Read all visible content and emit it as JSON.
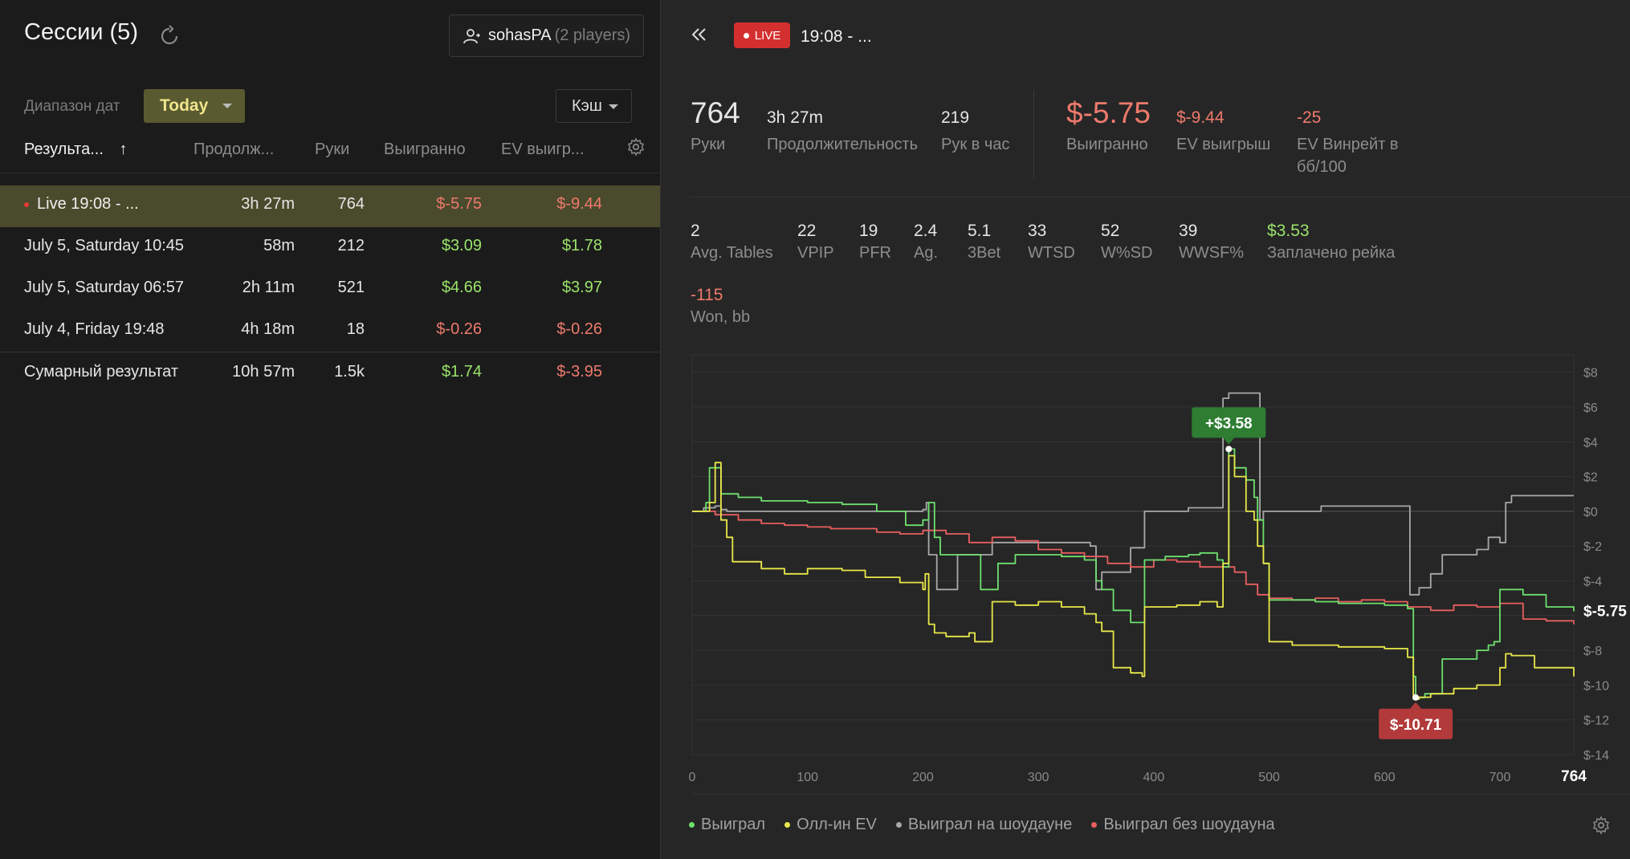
{
  "sessions": {
    "title": "Сессии (5)",
    "player_name": "sohasPA",
    "player_count": "(2 players)",
    "date_range_label": "Диапазон дат",
    "date_range_value": "Today",
    "game_type": "Кэш",
    "columns": [
      "Результа...",
      "Продолж...",
      "Руки",
      "Выигранно",
      "EV выигр..."
    ],
    "sort_arrow": "↑",
    "rows": [
      {
        "name": "Live 19:08 - ...",
        "duration": "3h 27m",
        "hands": "764",
        "won": "$-5.75",
        "ev": "$-9.44"
      },
      {
        "name": "July 5, Saturday 10:45",
        "duration": "58m",
        "hands": "212",
        "won": "$3.09",
        "ev": "$1.78"
      },
      {
        "name": "July 5, Saturday 06:57",
        "duration": "2h 11m",
        "hands": "521",
        "won": "$4.66",
        "ev": "$3.97"
      },
      {
        "name": "July 4, Friday 19:48",
        "duration": "4h 18m",
        "hands": "18",
        "won": "$-0.26",
        "ev": "$-0.26"
      }
    ],
    "total": {
      "name": "Сумарный результат",
      "duration": "10h 57m",
      "hands": "1.5k",
      "won": "$1.74",
      "ev": "$-3.95"
    }
  },
  "detail": {
    "live_badge": "LIVE",
    "session_time": "19:08 - ...",
    "summary": {
      "hands": "764",
      "hands_label": "Руки",
      "duration": "3h 27m",
      "duration_label": "Продолжительность",
      "hands_per_hour": "219",
      "hands_per_hour_label": "Рук в час",
      "won": "$-5.75",
      "won_label": "Выигранно",
      "ev_won": "$-9.44",
      "ev_won_label": "EV выигрыш",
      "ev_winrate": "-25",
      "ev_winrate_label_1": "EV Винрейт в",
      "ev_winrate_label_2": "бб/100"
    },
    "stats": [
      {
        "value": "2",
        "label": "Avg. Tables"
      },
      {
        "value": "22",
        "label": "VPIP"
      },
      {
        "value": "19",
        "label": "PFR"
      },
      {
        "value": "2.4",
        "label": "Ag."
      },
      {
        "value": "5.1",
        "label": "3Bet"
      },
      {
        "value": "33",
        "label": "WTSD"
      },
      {
        "value": "52",
        "label": "W%SD"
      },
      {
        "value": "39",
        "label": "WWSF%"
      },
      {
        "value": "$3.53",
        "label": "Заплачено рейка"
      },
      {
        "value": "-115",
        "label": "Won, bb"
      }
    ],
    "legend": [
      "Выиграл",
      "Олл-ин EV",
      "Выиграл на шоудауне",
      "Выиграл без шоудауна"
    ]
  },
  "colors": {
    "won": "#6ee06e",
    "allin_ev": "#e8e84a",
    "showdown": "#a9a9a9",
    "no_showdown": "#e95f5f",
    "positive": "#9be36b",
    "negative": "#ee7a6c",
    "live": "#d32f2f"
  },
  "icons": [
    "refresh-icon",
    "user-switch-icon",
    "gear-icon",
    "double-chevron-left-icon"
  ],
  "chart_data": {
    "type": "line",
    "xlim": [
      0,
      764
    ],
    "ylim": [
      -14,
      9
    ],
    "x_ticks": [
      0,
      100,
      200,
      300,
      400,
      500,
      600,
      700
    ],
    "x_tick_labels": [
      "0",
      "100",
      "200",
      "300",
      "400",
      "500",
      "600",
      "700"
    ],
    "x_end_label": "764",
    "y_ticks": [
      8,
      6,
      4,
      2,
      0,
      -2,
      -4,
      -6,
      -8,
      -10,
      -12,
      -14
    ],
    "y_tick_labels": [
      "$8",
      "$6",
      "$4",
      "$2",
      "$0",
      "$-2",
      "$-4",
      "",
      "$-8",
      "$-10",
      "$-12",
      "$-14"
    ],
    "current_label": "$-5.75",
    "max_callout": {
      "x": 465,
      "y": 3.58,
      "label": "+$3.58"
    },
    "min_callout": {
      "x": 627,
      "y": -10.71,
      "label": "$-10.71"
    },
    "series": [
      {
        "key": "showdown",
        "x": [
          0,
          10,
          20,
          25,
          30,
          160,
          200,
          203,
          205,
          210,
          212,
          225,
          230,
          250,
          260,
          340,
          345,
          350,
          355,
          370,
          380,
          390,
          392,
          425,
          430,
          455,
          460,
          465,
          470,
          490,
          492,
          495,
          500,
          520,
          540,
          545,
          580,
          600,
          620,
          622,
          625,
          628,
          630,
          640,
          650,
          655,
          660,
          670,
          680,
          690,
          700,
          705,
          710,
          720,
          740,
          764
        ],
        "y": [
          0,
          0.2,
          0.3,
          0.1,
          0,
          0,
          0.1,
          0.5,
          -2.5,
          -2.5,
          -4.5,
          -4.5,
          -2.5,
          -2.5,
          -1.8,
          -1.8,
          -2,
          -4.5,
          -3.5,
          -3.5,
          -2.1,
          -2.1,
          0,
          0,
          0.2,
          0.2,
          6.5,
          6.8,
          6.8,
          6.8,
          -0.5,
          0,
          0,
          0,
          0,
          0.3,
          0.3,
          0.3,
          0.3,
          -4.8,
          -4.8,
          -4.8,
          -4.4,
          -3.6,
          -2.5,
          -2.5,
          -2.5,
          -2.5,
          -2.2,
          -1.5,
          -1.8,
          0.5,
          0.9,
          0.9,
          0.9,
          0.9
        ]
      },
      {
        "key": "no_showdown",
        "x": [
          0,
          20,
          40,
          60,
          80,
          100,
          120,
          140,
          160,
          180,
          200,
          220,
          240,
          260,
          280,
          300,
          320,
          340,
          360,
          380,
          400,
          420,
          440,
          460,
          470,
          480,
          490,
          500,
          520,
          540,
          560,
          580,
          600,
          620,
          640,
          660,
          680,
          700,
          720,
          740,
          764
        ],
        "y": [
          0,
          -0.2,
          -0.5,
          -0.7,
          -0.8,
          -0.9,
          -1.0,
          -1.0,
          -1.2,
          -1.3,
          -1.1,
          -1.3,
          -1.8,
          -1.5,
          -1.7,
          -2.2,
          -2.4,
          -2.6,
          -3.0,
          -3.2,
          -2.8,
          -2.9,
          -3.2,
          -3.2,
          -3.5,
          -4.2,
          -4.8,
          -5.0,
          -5.1,
          -5.0,
          -5.2,
          -5.1,
          -5.2,
          -5.5,
          -5.7,
          -5.4,
          -5.5,
          -5.3,
          -6.2,
          -6.3,
          -6.5
        ]
      },
      {
        "key": "won",
        "x": [
          0,
          12,
          15,
          20,
          25,
          40,
          60,
          80,
          100,
          130,
          160,
          185,
          200,
          205,
          210,
          215,
          245,
          250,
          265,
          280,
          300,
          320,
          340,
          350,
          355,
          365,
          380,
          390,
          392,
          410,
          430,
          440,
          455,
          460,
          465,
          470,
          480,
          487,
          490,
          495,
          500,
          520,
          540,
          560,
          600,
          620,
          625,
          627,
          635,
          650,
          680,
          690,
          695,
          700,
          720,
          740,
          764
        ],
        "y": [
          0,
          0.5,
          2.5,
          2.5,
          1,
          0.8,
          0.6,
          0.6,
          0.5,
          0.4,
          0,
          -0.8,
          -0.5,
          0.5,
          -1.5,
          -2.5,
          -2.5,
          -4.5,
          -3.0,
          -2.5,
          -2.5,
          -2.6,
          -2.8,
          -4.0,
          -4.5,
          -5.7,
          -6.4,
          -6.4,
          -2.8,
          -2.6,
          -2.5,
          -2.4,
          -2.8,
          -3.2,
          3.58,
          2.5,
          1.8,
          0.8,
          -0.5,
          -3.0,
          -5.1,
          -5.1,
          -5.2,
          -5.3,
          -5.4,
          -5.6,
          -9.5,
          -10.71,
          -10.5,
          -8.5,
          -8.0,
          -7.7,
          -7.5,
          -4.5,
          -4.8,
          -5.5,
          -5.75
        ]
      },
      {
        "key": "allin_ev",
        "x": [
          0,
          15,
          20,
          25,
          30,
          35,
          60,
          80,
          100,
          130,
          150,
          180,
          200,
          202,
          205,
          210,
          220,
          240,
          245,
          260,
          280,
          300,
          320,
          340,
          350,
          355,
          365,
          380,
          390,
          392,
          420,
          440,
          455,
          460,
          465,
          470,
          480,
          487,
          490,
          495,
          500,
          520,
          560,
          600,
          620,
          625,
          630,
          640,
          660,
          680,
          700,
          705,
          710,
          730,
          764
        ],
        "y": [
          0,
          0.5,
          2.8,
          -0.5,
          -1.5,
          -2.9,
          -3.3,
          -3.6,
          -3.3,
          -3.4,
          -3.8,
          -4.1,
          -4.5,
          -3.6,
          -6.5,
          -7.0,
          -7.2,
          -7.0,
          -7.5,
          -5.2,
          -5.4,
          -5.2,
          -5.5,
          -5.9,
          -6.4,
          -6.9,
          -9.0,
          -9.3,
          -9.5,
          -5.5,
          -5.4,
          -5.2,
          -5.5,
          -3.0,
          3.2,
          2.0,
          0,
          -0.5,
          -2.0,
          -3.0,
          -7.5,
          -7.7,
          -7.8,
          -7.9,
          -8.4,
          -10.8,
          -10.7,
          -10.5,
          -10.2,
          -10.0,
          -9.0,
          -8.2,
          -8.3,
          -9.0,
          -9.5
        ]
      }
    ]
  }
}
